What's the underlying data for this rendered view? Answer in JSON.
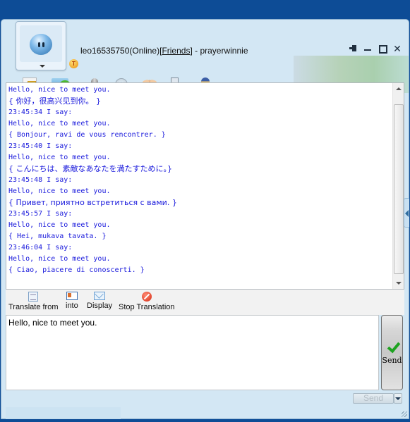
{
  "window": {
    "title_user": "leo16535750(Online)",
    "title_group_open": "[",
    "title_group": "Friends",
    "title_group_close": "]",
    "title_contact": " - prayerwinnie",
    "status_badge": "T"
  },
  "window_controls": [
    "pin",
    "minimize",
    "maximize",
    "close"
  ],
  "toolbar": {
    "items": [
      {
        "icon": "note-icon",
        "has_dropdown": true
      },
      {
        "icon": "file-transfer-icon",
        "has_dropdown": true
      },
      {
        "icon": "voice-icon",
        "has_dropdown": false
      },
      {
        "icon": "webcam-icon",
        "has_dropdown": false
      },
      {
        "icon": "group-icon",
        "has_dropdown": false
      },
      {
        "icon": "sms-icon",
        "has_dropdown": false
      },
      {
        "icon": "police-icon",
        "has_dropdown": true
      }
    ]
  },
  "chat": {
    "lines": [
      "Hello, nice to meet you.",
      "{ 你好，很高兴见到你。 }",
      "23:45:34 I say:",
      "Hello, nice to meet you.",
      "{ Bonjour, ravi de vous rencontrer. }",
      "23:45:40 I say:",
      "Hello, nice to meet you.",
      "{ こんにちは、素敵なあなたを満たすために。}",
      "23:45:48 I say:",
      "Hello, nice to meet you.",
      "{ Привет, приятно встретиться с вами. }",
      "23:45:57 I say:",
      "Hello, nice to meet you.",
      "{ Hei, mukava tavata. }",
      "23:46:04 I say:",
      "Hello, nice to meet you.",
      "{ Ciao, piacere di conoscerti. }"
    ]
  },
  "translation_bar": {
    "translate_from": "Translate from",
    "into": "into",
    "display": "Display",
    "stop": "Stop Translation"
  },
  "input": {
    "value": "Hello, nice to meet you."
  },
  "send": {
    "big_label": "Send",
    "small_label": "Send"
  },
  "colors": {
    "title_bar": "#0d4c96",
    "window_bg": "#d3e7f4",
    "chat_text": "#1a1adc"
  }
}
